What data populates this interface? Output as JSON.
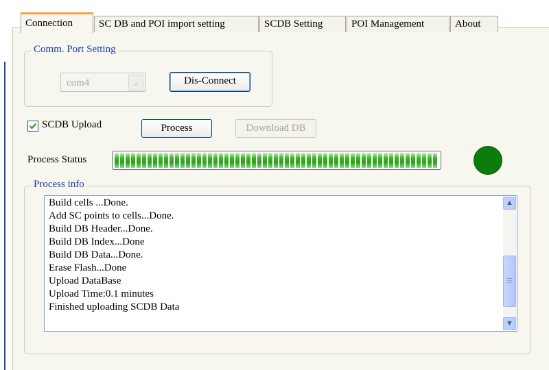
{
  "tabs": [
    {
      "label": "Connection",
      "active": true
    },
    {
      "label": "SC DB and POI import setting",
      "active": false
    },
    {
      "label": "SCDB  Setting",
      "active": false
    },
    {
      "label": "POI Management",
      "active": false
    },
    {
      "label": "About",
      "active": false
    }
  ],
  "comm_port": {
    "legend": "Comm. Port Setting",
    "port_value": "com4",
    "connect_button": "Dis-Connect",
    "dropdown_icon": "chevron-down-icon"
  },
  "scdb_upload": {
    "label": "SCDB Upload",
    "checked": true
  },
  "buttons": {
    "process": "Process",
    "download_db": "Download DB"
  },
  "status": {
    "label": "Process Status",
    "progress_fraction": 1.0,
    "indicator_color": "#0c7d0c",
    "bar_color": "#2aa11a"
  },
  "process_info": {
    "legend": "Process info",
    "lines": [
      "Build cells ...Done.",
      "Add SC points to cells...Done.",
      "Build DB Header...Done.",
      "Build DB Index...Done",
      "Build DB Data...Done.",
      "Erase Flash...Done",
      "Upload DataBase",
      "Upload Time:0.1 minutes",
      "Finished uploading SCDB Data"
    ]
  },
  "colors": {
    "accent": "#f4a23c",
    "legend_text": "#1a3ea8"
  }
}
